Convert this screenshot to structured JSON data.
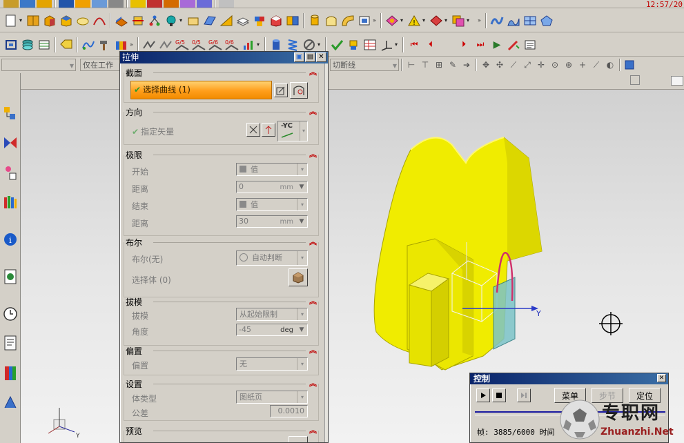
{
  "clock": "12:57/20",
  "selection_bar": {
    "filter_value": "",
    "scope": "仅在工作",
    "snap": "切断线"
  },
  "extrude_dialog": {
    "title": "拉伸",
    "section": {
      "header": "截面",
      "select_curve": "选择曲线 (1)"
    },
    "direction": {
      "header": "方向",
      "specify_vector": "指定矢量",
      "vector_value": "-YC"
    },
    "limits": {
      "header": "极限",
      "start_label": "开始",
      "start_value": "值",
      "start_distance_label": "距离",
      "start_distance": "0",
      "start_unit": "mm",
      "end_label": "结束",
      "end_value": "值",
      "end_distance_label": "距离",
      "end_distance": "30",
      "end_unit": "mm"
    },
    "boolean": {
      "header": "布尔",
      "boolean_label": "布尔(无)",
      "boolean_value": "自动判断",
      "select_body": "选择体 (0)"
    },
    "draft": {
      "header": "拔模",
      "draft_label": "拔模",
      "draft_value": "从起始限制",
      "angle_label": "角度",
      "angle_value": "-45",
      "angle_unit": "deg"
    },
    "offset": {
      "header": "偏置",
      "offset_label": "偏置",
      "offset_value": "无"
    },
    "settings": {
      "header": "设置",
      "body_type_label": "体类型",
      "body_type_value": "图纸页",
      "tolerance_label": "公差",
      "tolerance_value": "0.0010"
    },
    "preview": {
      "header": "预览"
    }
  },
  "control_panel": {
    "title": "控制",
    "menu_button": "菜单",
    "step_button": "步节",
    "locate_button": "定位",
    "frame_text": "帧: 3885/6000 时间"
  },
  "viewport": {
    "axis_label": "Y",
    "triad_label": "Y"
  },
  "watermark": {
    "text": "专职网",
    "url": "Zhuanzhi.Net"
  },
  "colors": {
    "model": "#f0ec00",
    "dialog_title": "#0a246a",
    "select_highlight": "#ff9e1b",
    "collapse_chevron": "#c00000"
  }
}
